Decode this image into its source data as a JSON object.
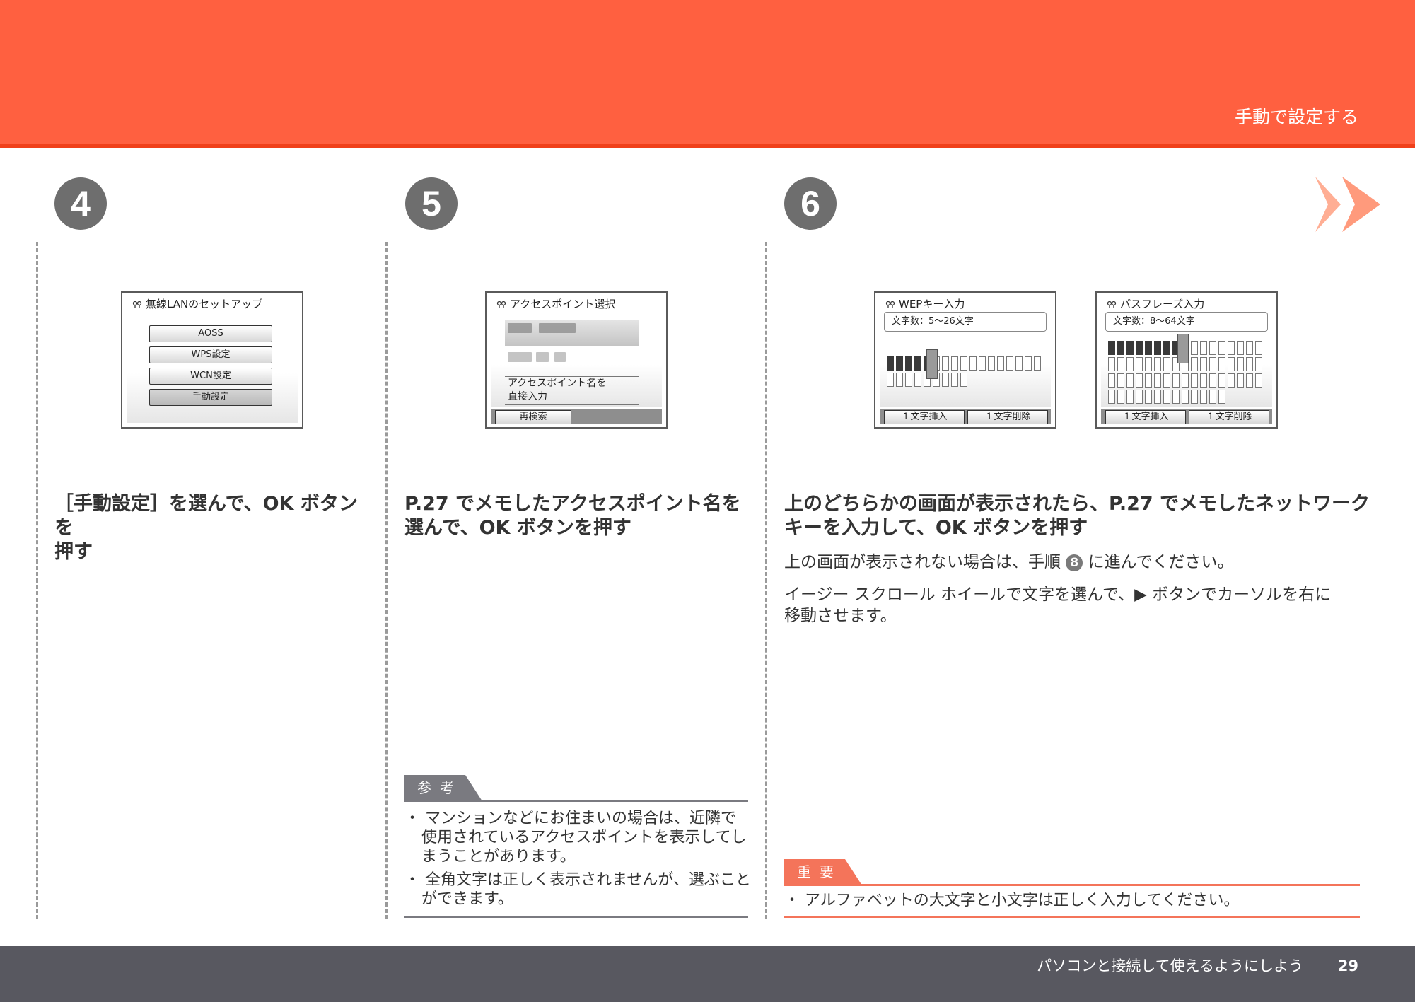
{
  "header": {
    "section_title": "手動で設定する"
  },
  "footer": {
    "text": "パソコンと接続して使えるようにしよう",
    "page_number": "29"
  },
  "steps": [
    {
      "number": "4",
      "screen": {
        "title": "無線LANのセットアップ",
        "buttons": [
          "AOSS",
          "WPS設定",
          "WCN設定",
          "手動設定"
        ],
        "selected_index": 3
      },
      "heading_line1": "［手動設定］を選んで、OK ボタンを",
      "heading_line2": "押す"
    },
    {
      "number": "5",
      "screen": {
        "title": "アクセスポイント選択",
        "direct_input_line1": "アクセスポイント名を",
        "direct_input_line2": "直接入力",
        "search_button": "再検索"
      },
      "heading_line1": "P.27 でメモしたアクセスポイント名を",
      "heading_line2": "選んで、OK ボタンを押す",
      "note": {
        "tag": "参考",
        "items": [
          "マンションなどにお住まいの場合は、近隣で使用されているアクセスポイントを表示してしまうことがあります。",
          "全角文字は正しく表示されませんが、選ぶことができます。"
        ]
      }
    },
    {
      "number": "6",
      "screens": [
        {
          "title": "WEPキー入力",
          "count": "文字数：5〜26文字",
          "insert": "１文字挿入",
          "delete": "１文字削除"
        },
        {
          "title": "パスフレーズ入力",
          "count": "文字数：8〜64文字",
          "insert": "１文字挿入",
          "delete": "１文字削除"
        }
      ],
      "heading_line1": "上のどちらかの画面が表示されたら、P.27 でメモしたネットワーク",
      "heading_line2": "キーを入力して、OK ボタンを押す",
      "body1_before": "上の画面が表示されない場合は、手順",
      "body1_step": "8",
      "body1_after": "に進んでください。",
      "body2_line1": "イージー スクロール ホイールで文字を選んで、▶ ボタンでカーソルを右に",
      "body2_line2": "移動させます。",
      "note": {
        "tag": "重要",
        "items": [
          "アルファベットの大文字と小文字は正しく入力してください。"
        ]
      }
    }
  ],
  "colors": {
    "header": "#ff6040",
    "footer": "#585860",
    "badge": "#6e6e6e",
    "note_tag_reference": "#7a7a80",
    "note_tag_important": "#f4745a"
  }
}
